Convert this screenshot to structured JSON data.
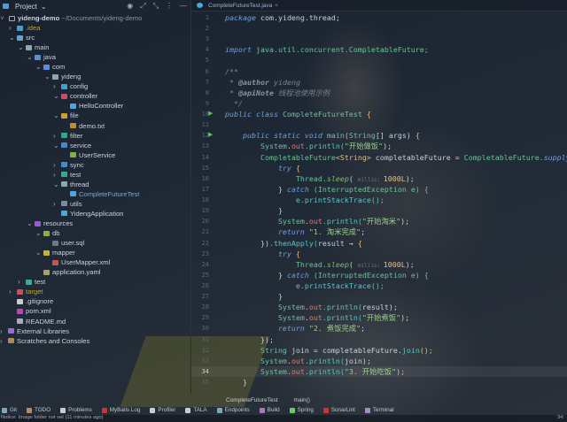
{
  "project": {
    "title": "Project",
    "root": "yideng-demo",
    "root_path": "~/Documents/yideng-demo"
  },
  "tree": [
    {
      "label": ".idea",
      "d": 1,
      "arrow": ">",
      "color": "#3fa0d0",
      "text": "#c9a227"
    },
    {
      "label": "src",
      "d": 1,
      "arrow": "v",
      "color": "#6a9fd0"
    },
    {
      "label": "main",
      "d": 2,
      "arrow": "v",
      "color": "#8aa"
    },
    {
      "label": "java",
      "d": 3,
      "arrow": "v",
      "color": "#5b8ed6"
    },
    {
      "label": "com",
      "d": 4,
      "arrow": "v",
      "color": "#5b8ed6"
    },
    {
      "label": "yideng",
      "d": 5,
      "arrow": "v",
      "color": "#8aa"
    },
    {
      "label": "config",
      "d": 6,
      "arrow": ">",
      "color": "#3fa0d0"
    },
    {
      "label": "controller",
      "d": 6,
      "arrow": "v",
      "color": "#d04a6a"
    },
    {
      "label": "HelloController",
      "d": 7,
      "arrow": "",
      "color": "#4aa8e0"
    },
    {
      "label": "file",
      "d": 6,
      "arrow": "v",
      "color": "#c9a227"
    },
    {
      "label": "demo.txt",
      "d": 7,
      "arrow": "",
      "color": "#c98a27"
    },
    {
      "label": "filter",
      "d": 6,
      "arrow": ">",
      "color": "#2fa88a"
    },
    {
      "label": "service",
      "d": 6,
      "arrow": "v",
      "color": "#3f8ad0"
    },
    {
      "label": "UserService",
      "d": 7,
      "arrow": "",
      "color": "#7cb342"
    },
    {
      "label": "sync",
      "d": 6,
      "arrow": ">",
      "color": "#3f8ad0"
    },
    {
      "label": "test",
      "d": 6,
      "arrow": ">",
      "color": "#2fb08a"
    },
    {
      "label": "thread",
      "d": 6,
      "arrow": "v",
      "color": "#8aa"
    },
    {
      "label": "CompleteFutureTest",
      "d": 7,
      "arrow": "",
      "color": "#4aa8e0",
      "text": "#6fa8dc"
    },
    {
      "label": "utils",
      "d": 6,
      "arrow": ">",
      "color": "#7a8aa0"
    },
    {
      "label": "YidengApplication",
      "d": 6,
      "arrow": "",
      "color": "#4aa8e0"
    },
    {
      "label": "resources",
      "d": 3,
      "arrow": "v",
      "color": "#9a5ad0"
    },
    {
      "label": "db",
      "d": 4,
      "arrow": "v",
      "color": "#8ab43a"
    },
    {
      "label": "user.sql",
      "d": 5,
      "arrow": "",
      "color": "#6a7a8a"
    },
    {
      "label": "mapper",
      "d": 4,
      "arrow": "v",
      "color": "#c9b227"
    },
    {
      "label": "UserMapper.xml",
      "d": 5,
      "arrow": "",
      "color": "#d05050"
    },
    {
      "label": "application.yaml",
      "d": 4,
      "arrow": "",
      "color": "#b0a060"
    },
    {
      "label": "test",
      "d": 2,
      "arrow": ">",
      "color": "#2fb0a0"
    },
    {
      "label": "target",
      "d": 1,
      "arrow": ">",
      "color": "#d04a5a",
      "text": "#c9a227"
    },
    {
      "label": ".gitignore",
      "d": 1,
      "arrow": "",
      "color": "#ccc"
    },
    {
      "label": "pom.xml",
      "d": 1,
      "arrow": "",
      "color": "#c040c0"
    },
    {
      "label": "README.md",
      "d": 1,
      "arrow": "",
      "color": "#aab"
    },
    {
      "label": "External Libraries",
      "d": 0,
      "arrow": ">",
      "color": "#9a6ad0"
    },
    {
      "label": "Scratches and Consoles",
      "d": 0,
      "arrow": ">",
      "color": "#b08a50"
    }
  ],
  "editor": {
    "tab": "CompleteFutureTest.java",
    "current_line": 34,
    "lines": [
      [
        [
          "package ",
          "kw"
        ],
        [
          "com.yideng.thread;",
          "tx"
        ]
      ],
      [],
      [],
      [
        [
          "import ",
          "kw"
        ],
        [
          "java.util.concurrent.CompletableFuture;",
          "ty"
        ]
      ],
      [],
      [
        [
          "/**",
          "cm"
        ]
      ],
      [
        [
          " * ",
          "cm"
        ],
        [
          "@author",
          "tg"
        ],
        [
          " yideng",
          "cm"
        ]
      ],
      [
        [
          " * ",
          "cm"
        ],
        [
          "@apiNote",
          "tg"
        ],
        [
          " 线程池使用示例",
          "cm"
        ]
      ],
      [
        [
          "  */",
          "cm"
        ]
      ],
      [
        [
          "public class ",
          "kw"
        ],
        [
          "CompleteFutureTest ",
          "ty"
        ],
        [
          "{",
          "br"
        ]
      ],
      [],
      [
        [
          "    public static void ",
          "kw"
        ],
        [
          "main",
          "mt"
        ],
        [
          "(",
          "br"
        ],
        [
          "String",
          "ty"
        ],
        [
          "[] args) ",
          "tx"
        ],
        [
          "{",
          "br"
        ]
      ],
      [
        [
          "        System",
          "ty"
        ],
        [
          ".",
          "tx"
        ],
        [
          "out",
          "fd"
        ],
        [
          ".println(",
          "mt"
        ],
        [
          "\"开始做饭\"",
          "st"
        ],
        [
          ");",
          "tx"
        ]
      ],
      [
        [
          "        CompletableFuture",
          "ty"
        ],
        [
          "<String> ",
          "nm"
        ],
        [
          "completableFuture = ",
          "tx"
        ],
        [
          "CompletableFuture.",
          "ty"
        ],
        [
          "supplyAsync",
          "kw"
        ]
      ],
      [
        [
          "            try ",
          "kw"
        ],
        [
          "{",
          "br"
        ]
      ],
      [
        [
          "                Thread.",
          "ty"
        ],
        [
          "sleep",
          "stc"
        ],
        [
          "( ",
          "tx"
        ],
        [
          "millis: ",
          "hint"
        ],
        [
          "1000L",
          "nm"
        ],
        [
          ");",
          "tx"
        ]
      ],
      [
        [
          "            } ",
          "tx"
        ],
        [
          "catch ",
          "kw"
        ],
        [
          "(InterruptedException e) {",
          "ty"
        ]
      ],
      [
        [
          "                e.printStackTrace();",
          "mt"
        ]
      ],
      [
        [
          "            }",
          "tx"
        ]
      ],
      [
        [
          "            System",
          "ty"
        ],
        [
          ".",
          "tx"
        ],
        [
          "out",
          "fd"
        ],
        [
          ".println(",
          "mt"
        ],
        [
          "\"开始淘米\"",
          "st"
        ],
        [
          ");",
          "tx"
        ]
      ],
      [
        [
          "            return ",
          "kw"
        ],
        [
          "\"1. 淘米完成\"",
          "st"
        ],
        [
          ";",
          "tx"
        ]
      ],
      [
        [
          "        })",
          "tx"
        ],
        [
          ".thenApply(",
          "mt"
        ],
        [
          "result → ",
          "tx"
        ],
        [
          "{",
          "br"
        ]
      ],
      [
        [
          "            try ",
          "kw"
        ],
        [
          "{",
          "br"
        ]
      ],
      [
        [
          "                Thread.",
          "ty"
        ],
        [
          "sleep",
          "stc"
        ],
        [
          "( ",
          "tx"
        ],
        [
          "millis: ",
          "hint"
        ],
        [
          "1000L",
          "nm"
        ],
        [
          ");",
          "tx"
        ]
      ],
      [
        [
          "            } ",
          "tx"
        ],
        [
          "catch ",
          "kw"
        ],
        [
          "(InterruptedException e) {",
          "ty"
        ]
      ],
      [
        [
          "                e.printStackTrace();",
          "mt"
        ]
      ],
      [
        [
          "            }",
          "tx"
        ]
      ],
      [
        [
          "            System",
          "ty"
        ],
        [
          ".",
          "tx"
        ],
        [
          "out",
          "fd"
        ],
        [
          ".println(",
          "mt"
        ],
        [
          "result",
          "tx"
        ],
        [
          ");",
          "tx"
        ]
      ],
      [
        [
          "            System",
          "ty"
        ],
        [
          ".",
          "tx"
        ],
        [
          "out",
          "fd"
        ],
        [
          ".println(",
          "mt"
        ],
        [
          "\"开始煮饭\"",
          "st"
        ],
        [
          ");",
          "tx"
        ]
      ],
      [
        [
          "            return ",
          "kw"
        ],
        [
          "\"2. 煮饭完成\"",
          "st"
        ],
        [
          ";",
          "tx"
        ]
      ],
      [
        [
          "        });",
          "tx"
        ]
      ],
      [
        [
          "        String ",
          "ty"
        ],
        [
          "join = completableFuture.",
          "tx"
        ],
        [
          "join",
          "mt"
        ],
        [
          "();",
          "br"
        ]
      ],
      [
        [
          "        System",
          "ty"
        ],
        [
          ".",
          "tx"
        ],
        [
          "out",
          "fd"
        ],
        [
          ".println(",
          "mt"
        ],
        [
          "join",
          "tx"
        ],
        [
          ");",
          "tx"
        ]
      ],
      [
        [
          "        System",
          "ty"
        ],
        [
          ".",
          "tx"
        ],
        [
          "out",
          "fd"
        ],
        [
          ".println(",
          "mt"
        ],
        [
          "\"3. 开始吃饭\"",
          "st"
        ],
        [
          ");",
          "br"
        ]
      ],
      [
        [
          "    }",
          "tx"
        ]
      ]
    ]
  },
  "breadcrumbs": [
    "CompleteFutureTest",
    "main()"
  ],
  "toolwindows": [
    "Git",
    "TODO",
    "Problems",
    "MyBatis Log",
    "Profiler",
    "TALA",
    "Endpoints",
    "Build",
    "Spring",
    "SonarLint",
    "Terminal"
  ],
  "status": {
    "notice": "Notice: Image folder not set (11 minutes ago)",
    "position": "34:"
  }
}
